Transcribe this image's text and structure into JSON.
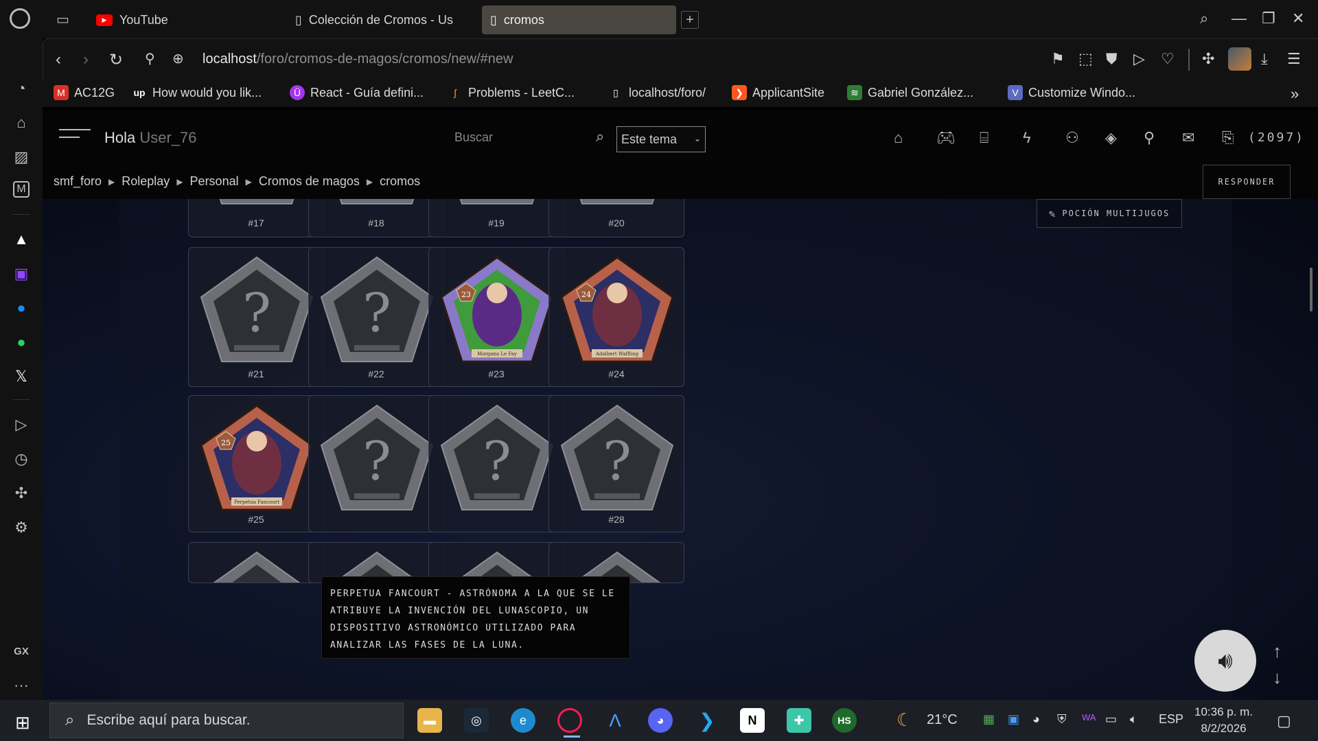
{
  "browser": {
    "tabs": [
      {
        "label": "YouTube",
        "icon": "youtube-icon"
      },
      {
        "label": "Colección de Cromos - Us",
        "icon": "page-icon"
      },
      {
        "label": "cromos",
        "icon": "page-icon"
      }
    ],
    "url_host": "localhost",
    "url_path": "/foro/cromos-de-magos/cromos/new/#new"
  },
  "bookmarks": [
    {
      "label": "AC12G",
      "icon": "gmail-icon",
      "color": "#d93025"
    },
    {
      "label": "How would you lik...",
      "icon": "upwork-icon",
      "color": "#121212"
    },
    {
      "label": "React - Guía defini...",
      "icon": "udemy-icon",
      "color": "#a435f0"
    },
    {
      "label": "Problems - LeetC...",
      "icon": "leetcode-icon",
      "color": "#121212"
    },
    {
      "label": "localhost/foro/",
      "icon": "page-icon",
      "color": "#121212"
    },
    {
      "label": "ApplicantSite",
      "icon": "applicant-icon",
      "color": "#ff5722"
    },
    {
      "label": "Gabriel González...",
      "icon": "site-icon",
      "color": "#2e7d32"
    },
    {
      "label": "Customize Windo...",
      "icon": "vs-icon",
      "color": "#5c6bc0"
    }
  ],
  "forum": {
    "greeting": "Hola",
    "username": "User_76",
    "search_label": "Buscar",
    "scope_select": "Este tema",
    "notification_count": "(2097)",
    "breadcrumb": [
      "smf_foro",
      "Roleplay",
      "Personal",
      "Cromos de magos",
      "cromos"
    ],
    "reply_button": "RESPONDER",
    "potion_button": "POCIÓN MULTIJUGOS"
  },
  "cards": [
    {
      "num": "#17",
      "collected": false
    },
    {
      "num": "#18",
      "collected": false
    },
    {
      "num": "#19",
      "collected": false
    },
    {
      "num": "#20",
      "collected": false
    },
    {
      "num": "#21",
      "collected": false
    },
    {
      "num": "#22",
      "collected": false
    },
    {
      "num": "#23",
      "collected": true,
      "badge": "23",
      "frame": "#8a79c9",
      "caption": "Morgana Le Fay"
    },
    {
      "num": "#24",
      "collected": true,
      "badge": "24",
      "frame": "#b8614a",
      "caption": "Adalbert Waffling"
    },
    {
      "num": "#25",
      "collected": true,
      "badge": "25",
      "frame": "#b8614a",
      "caption": "Perpetua Fancourt"
    },
    {
      "num": "",
      "collected": false
    },
    {
      "num": "",
      "collected": false
    },
    {
      "num": "#28",
      "collected": false
    }
  ],
  "tooltip": "Perpetua Fancourt - Astrónoma a la que se le atribuye la invención del lunascopio, un dispositivo astronómico utilizado para analizar las fases de la luna.",
  "taskbar": {
    "search_placeholder": "Escribe aquí para buscar.",
    "weather": "21°C",
    "language": "ESP",
    "time": "10:36 p. m.",
    "date": "8/2/2026"
  }
}
